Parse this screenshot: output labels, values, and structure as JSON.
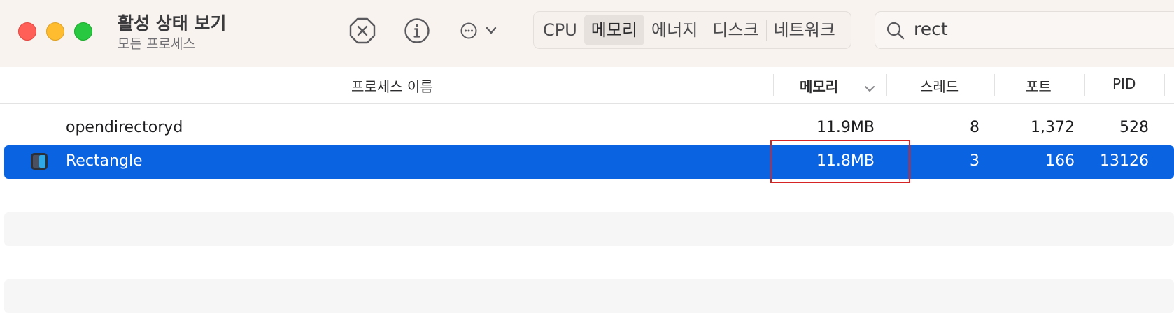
{
  "window": {
    "title": "활성 상태 보기",
    "subtitle": "모든 프로세스"
  },
  "toolbar": {
    "icons": [
      "stop-process-icon",
      "info-icon",
      "more-actions-icon"
    ],
    "tabs": [
      {
        "label": "CPU",
        "active": false
      },
      {
        "label": "메모리",
        "active": true
      },
      {
        "label": "에너지",
        "active": false
      },
      {
        "label": "디스크",
        "active": false
      },
      {
        "label": "네트워크",
        "active": false
      }
    ],
    "search": {
      "value": "rect"
    }
  },
  "table": {
    "columns": {
      "name": "프로세스 이름",
      "memory": "메모리",
      "threads": "스레드",
      "ports": "포트",
      "pid": "PID"
    },
    "sort_column": "memory",
    "sort_direction": "descending",
    "rows": [
      {
        "name": "opendirectoryd",
        "memory": "11.9MB",
        "threads": "8",
        "ports": "1,372",
        "pid": "528",
        "selected": false
      },
      {
        "name": "Rectangle",
        "memory": "11.8MB",
        "threads": "3",
        "ports": "166",
        "pid": "13126",
        "selected": true
      }
    ]
  },
  "colors": {
    "selection": "#0a63e0",
    "highlight_box": "#d62424",
    "toolbar_bg": "#f8f3ef"
  }
}
